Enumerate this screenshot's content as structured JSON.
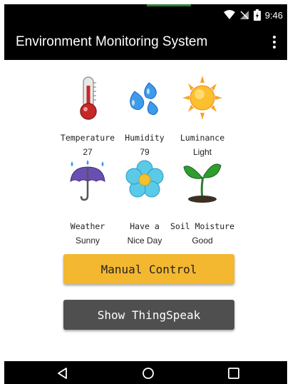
{
  "status_bar": {
    "time": "9:46",
    "icons": [
      "wifi-icon",
      "no-signal-icon",
      "battery-icon"
    ]
  },
  "app_bar": {
    "title": "Environment Monitoring System",
    "menu_icon": "overflow-menu-icon"
  },
  "sensors": [
    {
      "icon": "thermometer-icon",
      "label": "Temperature",
      "value": "27"
    },
    {
      "icon": "water-drops-icon",
      "label": "Humidity",
      "value": "79"
    },
    {
      "icon": "sun-icon",
      "label": "Luminance",
      "value": "Light"
    },
    {
      "icon": "rain-umbrella-icon",
      "label": "Weather",
      "value": "Sunny"
    },
    {
      "icon": "flower-icon",
      "label": "Have a",
      "value": "Nice Day"
    },
    {
      "icon": "sprout-icon",
      "label": "Soil Moisture",
      "value": "Good"
    }
  ],
  "buttons": {
    "manual_control": "Manual Control",
    "show_thingspeak": "Show ThingSpeak"
  },
  "nav_bar": {
    "items": [
      "back-icon",
      "home-icon",
      "recents-icon"
    ]
  },
  "colors": {
    "manual_button": "#f4b730",
    "thingspeak_button": "#4f4f4f",
    "bars": "#000000"
  }
}
